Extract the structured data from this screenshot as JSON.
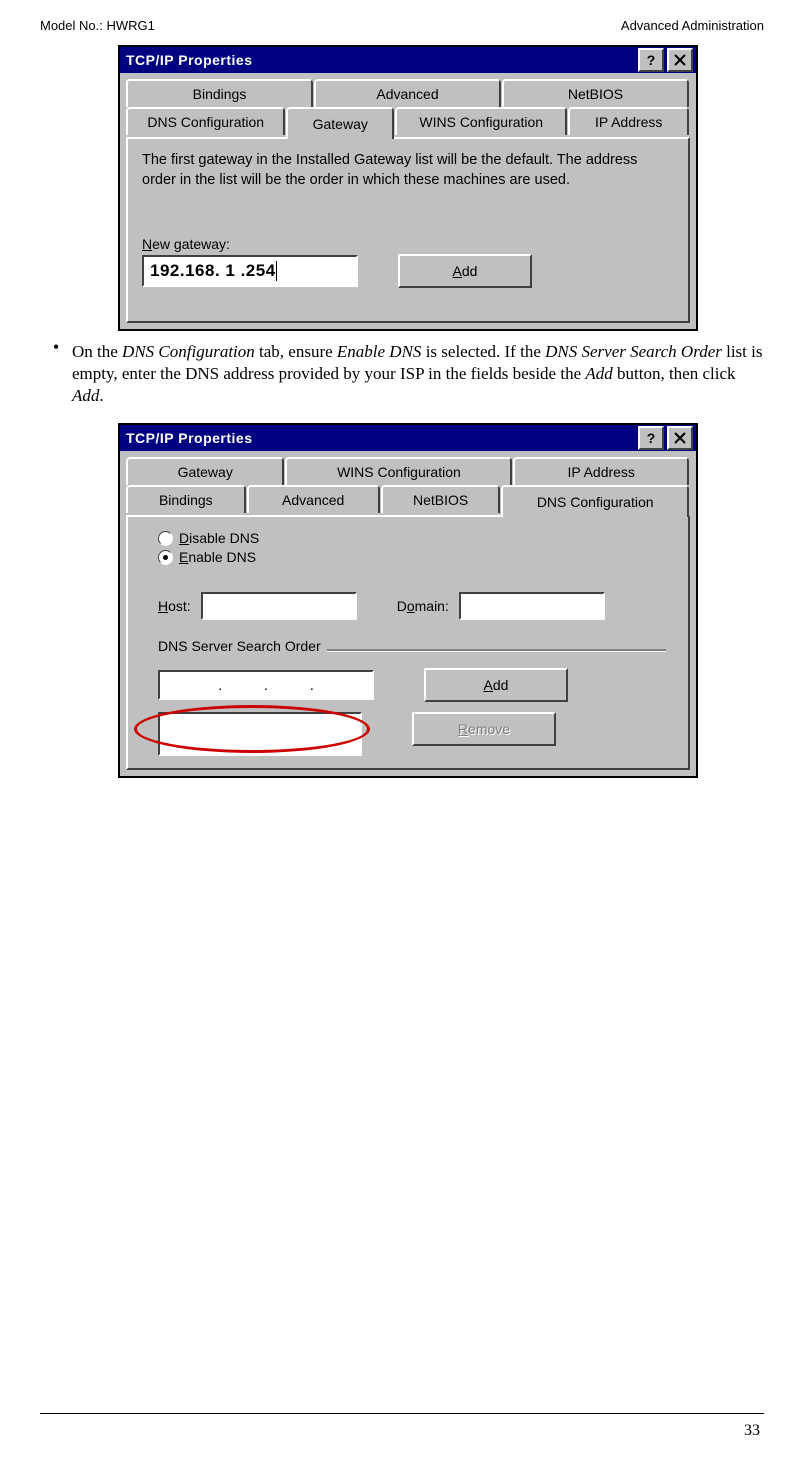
{
  "header": {
    "left": "Model No.: HWRG1",
    "right": "Advanced Administration"
  },
  "bulletText": {
    "part1": "On the ",
    "dnsConfig": "DNS Configuration",
    "part2": " tab, ensure ",
    "enableDns": "Enable DNS",
    "part3": " is selected. If the ",
    "dnsOrder": "DNS Server Search Order",
    "part4": " list is empty, enter the DNS address provided by your ISP in the fields beside the ",
    "addBtn": "Add",
    "part5": " button, then click ",
    "addBtn2": "Add",
    "part6": "."
  },
  "dialog1": {
    "title": "TCP/IP Properties",
    "tabsRow1": [
      "Bindings",
      "Advanced",
      "NetBIOS"
    ],
    "tabsRow2": [
      "DNS Configuration",
      "Gateway",
      "WINS Configuration",
      "IP Address"
    ],
    "activeTab": "Gateway",
    "description": "The first gateway in the Installed Gateway list will be the default. The address order in the list will be the order in which these machines are used.",
    "newGatewayLabel": "New gateway:",
    "newGatewayValue": "192.168. 1 .254",
    "addButton": "Add"
  },
  "dialog2": {
    "title": "TCP/IP Properties",
    "tabsRow1": [
      "Gateway",
      "WINS Configuration",
      "IP Address"
    ],
    "tabsRow2": [
      "Bindings",
      "Advanced",
      "NetBIOS",
      "DNS Configuration"
    ],
    "activeTab": "DNS Configuration",
    "radioDisable": "Disable DNS",
    "radioEnable": "Enable DNS",
    "hostLabel": "Host:",
    "domainLabel": "Domain:",
    "searchOrderLabel": "DNS Server Search Order",
    "ipDots": ".          .          .",
    "addButton": "Add",
    "removeButton": "Remove"
  },
  "pageNumber": "33"
}
